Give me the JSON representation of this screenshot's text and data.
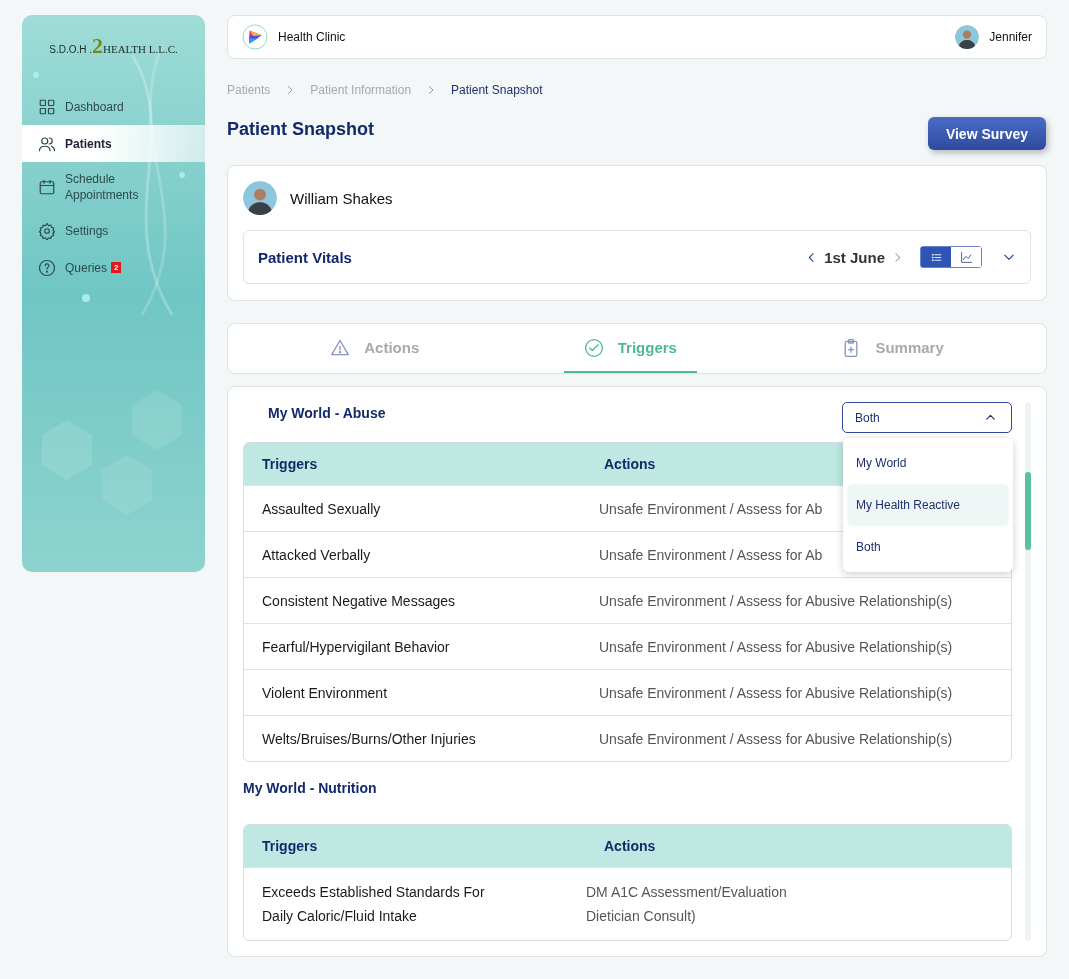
{
  "sidebar": {
    "logo": {
      "left": "S.D.O.H .",
      "number": "2",
      "right": "HEALTH L.L.C."
    },
    "items": [
      {
        "label": "Dashboard",
        "selected": false
      },
      {
        "label": "Patients",
        "selected": true
      },
      {
        "label": "Schedule Appointments",
        "selected": false
      },
      {
        "label": "Settings",
        "selected": false
      },
      {
        "label": "Queries",
        "selected": false,
        "badge": "2"
      }
    ]
  },
  "topbar": {
    "clinic": "Health Clinic",
    "user": "Jennifer"
  },
  "breadcrumb": [
    {
      "label": "Patients",
      "current": false
    },
    {
      "label": "Patient Information",
      "current": false
    },
    {
      "label": "Patient Snapshot",
      "current": true
    }
  ],
  "page_title": "Patient Snapshot",
  "view_survey_button": "View Survey",
  "patient": {
    "name": "William Shakes",
    "vitals": {
      "title": "Patient Vitals",
      "date": "1st June",
      "view_modes": [
        {
          "kind": "list",
          "selected": true
        },
        {
          "kind": "chart",
          "selected": false
        }
      ]
    }
  },
  "tabs": [
    {
      "label": "Actions",
      "selected": false
    },
    {
      "label": "Triggers",
      "selected": true
    },
    {
      "label": "Summary",
      "selected": false
    }
  ],
  "sections": [
    {
      "title": "My World - Abuse",
      "filter": {
        "value": "Both",
        "expanded": true,
        "options": [
          {
            "label": "My World",
            "highlighted": false
          },
          {
            "label": "My Health Reactive",
            "highlighted": true
          },
          {
            "label": "Both",
            "highlighted": false
          }
        ]
      },
      "columns": [
        "Triggers",
        "Actions"
      ],
      "rows": [
        {
          "trigger": [
            "Assaulted Sexually"
          ],
          "action": [
            "Unsafe Environment / Assess for Ab"
          ]
        },
        {
          "trigger": [
            "Attacked Verbally"
          ],
          "action": [
            "Unsafe Environment / Assess for Ab"
          ]
        },
        {
          "trigger": [
            "Consistent Negative Messages"
          ],
          "action": [
            "Unsafe Environment / Assess for Abusive Relationship(s)"
          ]
        },
        {
          "trigger": [
            "Fearful/Hypervigilant Behavior"
          ],
          "action": [
            "Unsafe Environment / Assess for Abusive Relationship(s)"
          ]
        },
        {
          "trigger": [
            "Violent Environment"
          ],
          "action": [
            "Unsafe Environment / Assess for Abusive Relationship(s)"
          ]
        },
        {
          "trigger": [
            "Welts/Bruises/Burns/Other Injuries"
          ],
          "action": [
            "Unsafe Environment / Assess for Abusive Relationship(s)"
          ]
        }
      ]
    },
    {
      "title": "My World - Nutrition",
      "columns": [
        "Triggers",
        "Actions"
      ],
      "rows": [
        {
          "trigger": [
            "Exceeds Established Standards For",
            "Daily Caloric/Fluid Intake"
          ],
          "action": [
            "DM A1C Assessment/Evaluation",
            "Dietician Consult)"
          ]
        }
      ]
    }
  ]
}
